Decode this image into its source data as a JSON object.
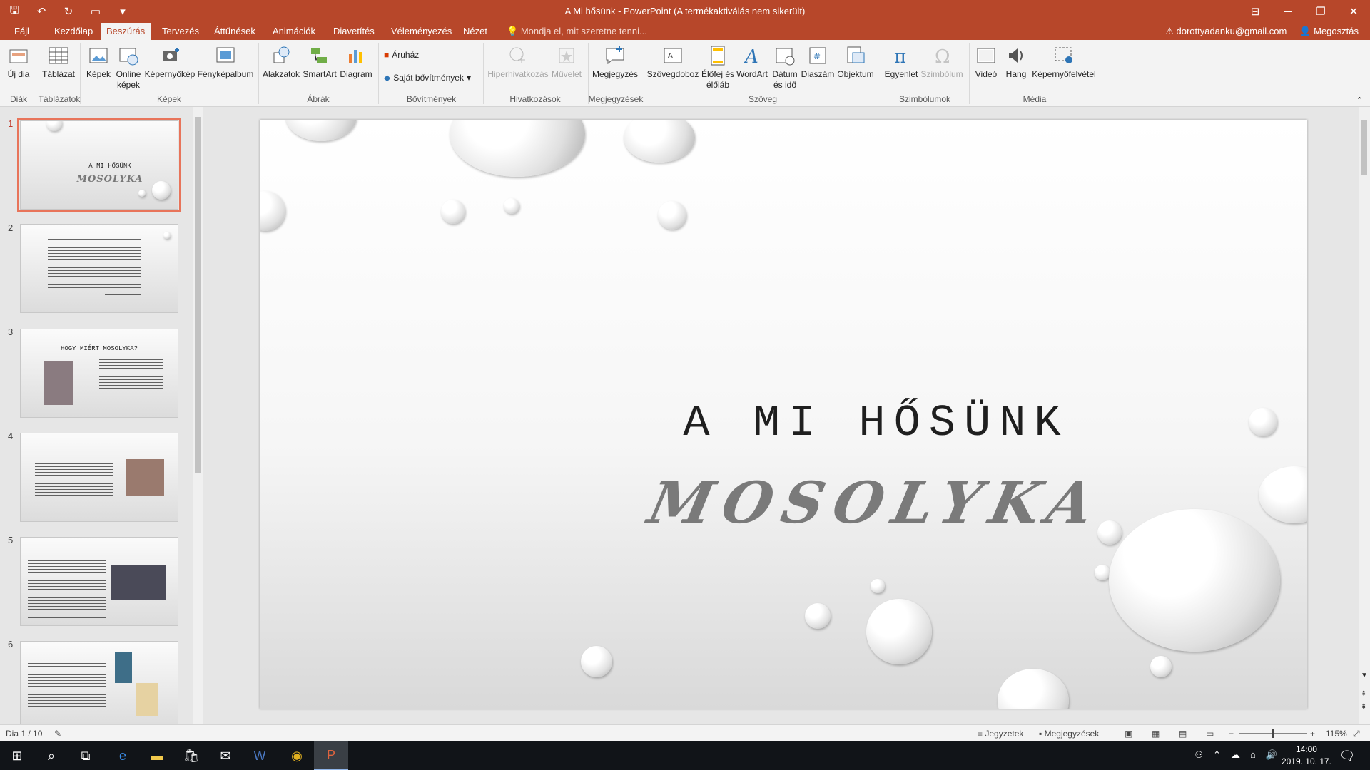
{
  "window": {
    "title": "A Mi hősünk - PowerPoint (A termékaktiválás nem sikerült)"
  },
  "tabs": [
    {
      "label": "Fájl"
    },
    {
      "label": "Kezdőlap"
    },
    {
      "label": "Beszúrás"
    },
    {
      "label": "Tervezés"
    },
    {
      "label": "Áttűnések"
    },
    {
      "label": "Animációk"
    },
    {
      "label": "Diavetítés"
    },
    {
      "label": "Véleményezés"
    },
    {
      "label": "Nézet"
    }
  ],
  "tellme": "Mondja el, mit szeretne tenni...",
  "account": "dorottyadanku@gmail.com",
  "share": "Megosztás",
  "ribbon": {
    "buttons": {
      "new_slide": "Új dia",
      "table": "Táblázat",
      "pictures": "Képek",
      "online_pictures": "Online képek",
      "screenshot": "Képernyőkép",
      "photo_album": "Fényképalbum",
      "shapes": "Alakzatok",
      "smartart": "SmartArt",
      "chart": "Diagram",
      "store": "Áruház",
      "my_addins": "Saját bővítmények",
      "hyperlink": "Hiperhivatkozás",
      "action": "Művelet",
      "comment": "Megjegyzés",
      "textbox": "Szövegdoboz",
      "header_footer": "Élőfej és élőláb",
      "wordart": "WordArt",
      "date_time": "Dátum és idő",
      "slide_number": "Diaszám",
      "object": "Objektum",
      "equation": "Egyenlet",
      "symbol": "Szimbólum",
      "video": "Videó",
      "audio": "Hang",
      "screen_recording": "Képernyőfelvétel"
    },
    "groups": {
      "slides": "Diák",
      "tables": "Táblázatok",
      "images": "Képek",
      "illustrations": "Ábrák",
      "addins": "Bővítmények",
      "links": "Hivatkozások",
      "comments": "Megjegyzések",
      "text": "Szöveg",
      "symbols": "Szimbólumok",
      "media": "Média"
    }
  },
  "thumbnails": [
    {
      "number": "1",
      "title": "A MI HŐSÜNK",
      "subtitle": "MOSOLYKA"
    },
    {
      "number": "2"
    },
    {
      "number": "3",
      "title": "HOGY MIÉRT MOSOLYKA?"
    },
    {
      "number": "4"
    },
    {
      "number": "5"
    },
    {
      "number": "6"
    }
  ],
  "slide": {
    "title": "A MI HŐSÜNK",
    "subtitle": "MOSOLYKA"
  },
  "status": {
    "slide_position": "Dia 1 / 10",
    "notes": "Jegyzetek",
    "comments": "Megjegyzések",
    "zoom": "115%"
  },
  "taskbar": {
    "time": "14:00",
    "date": "2019. 10. 17."
  },
  "colors": {
    "accent": "#b7472a",
    "selected_thumb_border": "#e8745a"
  }
}
